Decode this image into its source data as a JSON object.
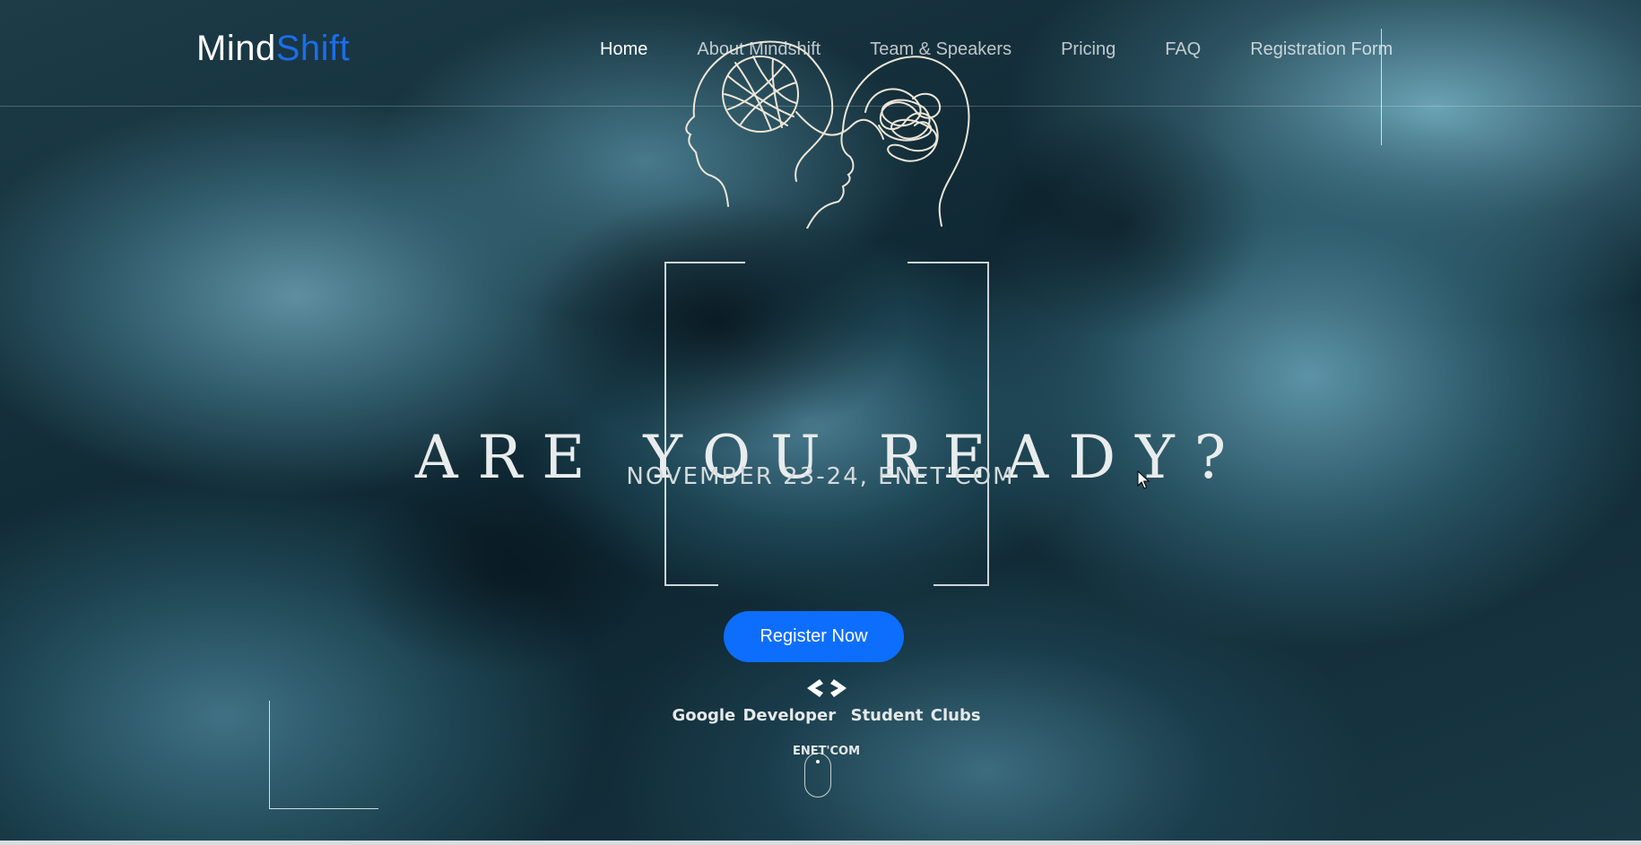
{
  "brand": {
    "part1": "Mind",
    "part2": "Shift"
  },
  "nav": {
    "items": [
      {
        "label": "Home",
        "active": true
      },
      {
        "label": "About Mindshift",
        "active": false
      },
      {
        "label": "Team & Speakers",
        "active": false
      },
      {
        "label": "Pricing",
        "active": false
      },
      {
        "label": "FAQ",
        "active": false
      },
      {
        "label": "Registration Form",
        "active": false
      }
    ]
  },
  "hero": {
    "headline": "ARE YOU READY?",
    "subline": "NOVEMBER 23-24, ENET'COM",
    "cta_label": "Register Now",
    "illustration": "tangled-thoughts-heads-icon"
  },
  "organizer": {
    "icon": "gdsc-brackets-icon",
    "name": "Google Developer  Student Clubs",
    "chapter": "ENET'COM"
  },
  "colors": {
    "accent": "#0d6efd",
    "brand_secondary": "#1a6eea",
    "text": "#ffffff",
    "background": "#1d3c48"
  }
}
